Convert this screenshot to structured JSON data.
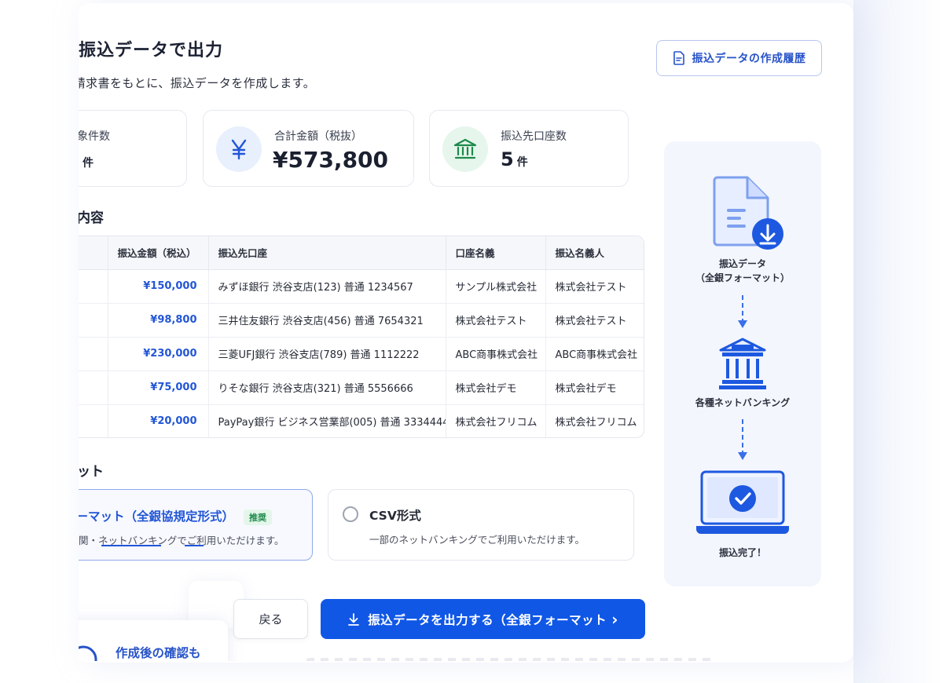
{
  "page": {
    "title": "振込データで出力",
    "subtitle": "た請求書をもとに、振込データを作成します。",
    "history_button": "振込データの作成履歴"
  },
  "stats": [
    {
      "label": "象件数",
      "value": "",
      "unit": "件",
      "icon": "document-icon"
    },
    {
      "label": "合計金額（税抜）",
      "value": "¥573,800",
      "unit": "",
      "icon": "yen-icon"
    },
    {
      "label": "振込先口座数",
      "value": "5",
      "unit": "件",
      "icon": "bank-icon"
    }
  ],
  "details": {
    "heading": "内容",
    "columns": [
      "",
      "振込金額（税込）",
      "振込先口座",
      "口座名義",
      "振込名義人"
    ],
    "rows": [
      {
        "c0": ":",
        "amount": "¥150,000",
        "account": "みずほ銀行 渋谷支店(123) 普通 1234567",
        "holder": "サンプル株式会社",
        "payer": "株式会社テスト"
      },
      {
        "c0": "",
        "amount": "¥98,800",
        "account": "三井住友銀行 渋谷支店(456) 普通 7654321",
        "holder": "株式会社テスト",
        "payer": "株式会社テスト"
      },
      {
        "c0": ":",
        "amount": "¥230,000",
        "account": "三菱UFJ銀行 渋谷支店(789) 普通 1112222",
        "holder": "ABC商事株式会社",
        "payer": "ABC商事株式会社"
      },
      {
        "c0": "",
        "amount": "¥75,000",
        "account": "りそな銀行 渋谷支店(321) 普通 5556666",
        "holder": "株式会社デモ",
        "payer": "株式会社デモ"
      },
      {
        "c0": ".",
        "amount": "¥20,000",
        "account": "PayPay銀行 ビジネス営業部(005) 普通 3334444",
        "holder": "株式会社フリコム",
        "payer": "株式会社フリコム"
      }
    ]
  },
  "format": {
    "heading": "ット",
    "options": [
      {
        "title": "ォーマット（全銀協規定形式）",
        "badge": "推奨",
        "desc": "融機関・ネットバンキングでご利用いただけます。",
        "selected": true
      },
      {
        "title": "CSV形式",
        "badge": "",
        "desc": "一部のネットバンキングでご利用いただけます。",
        "selected": false
      }
    ]
  },
  "flow": {
    "step1": "振込データ",
    "step1_sub": "（全銀フォーマット）",
    "step2": "各種ネットバンキング",
    "step3": "振込完了！"
  },
  "actions": {
    "back": "戻る",
    "export": "振込データを出力する（全銀フォーマット",
    "export_chevron": "›"
  },
  "note": {
    "title": "作成後の確認も"
  },
  "colors": {
    "primary": "#1057e6",
    "accent_blue": "#2356d6",
    "green": "#1d8a4a"
  }
}
